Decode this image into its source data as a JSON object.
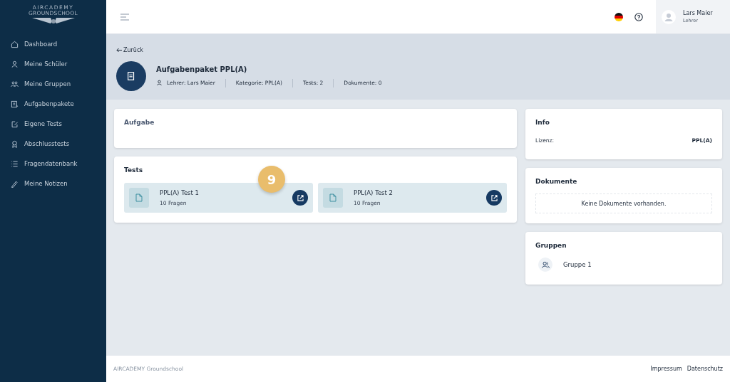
{
  "logo": {
    "line1": "AIRCADEMY",
    "line2": "GROUNDSCHOOL"
  },
  "sidebar": {
    "items": [
      {
        "label": "Dashboard",
        "selected": false
      },
      {
        "label": "Meine Schüler",
        "selected": false
      },
      {
        "label": "Meine Gruppen",
        "selected": false
      },
      {
        "label": "Aufgabenpakete",
        "selected": false
      },
      {
        "label": "Eigene Tests",
        "selected": false
      },
      {
        "label": "Abschlusstests",
        "selected": false
      },
      {
        "label": "Fragendatenbank",
        "selected": false
      },
      {
        "label": "Meine Notizen",
        "selected": false
      }
    ]
  },
  "user": {
    "name": "Lars Maier",
    "role": "Lehrer"
  },
  "header": {
    "back": "Zurück",
    "title": "Aufgabenpaket PPL(A)",
    "meta": [
      "Lehrer: Lars Maier",
      "Kategorie: PPL(A)",
      "Tests: 2",
      "Dokumente: 0"
    ]
  },
  "task": {
    "title": "Aufgabe"
  },
  "tests": {
    "title": "Tests",
    "items": [
      {
        "name": "PPL(A) Test 1",
        "questions": "10 Fragen"
      },
      {
        "name": "PPL(A) Test 2",
        "questions": "10 Fragen"
      }
    ]
  },
  "step_badge": "9",
  "info": {
    "title": "Info",
    "rows": [
      {
        "label": "Lizenz:",
        "value": "PPL(A)"
      }
    ]
  },
  "documents": {
    "title": "Dokumente",
    "empty": "Keine Dokumente vorhanden."
  },
  "groups": {
    "title": "Gruppen",
    "items": [
      "Gruppe 1"
    ]
  },
  "footer": {
    "brand": "AIRCADEMY Groundschool",
    "links": [
      "Impressum",
      "Datenschutz"
    ]
  }
}
